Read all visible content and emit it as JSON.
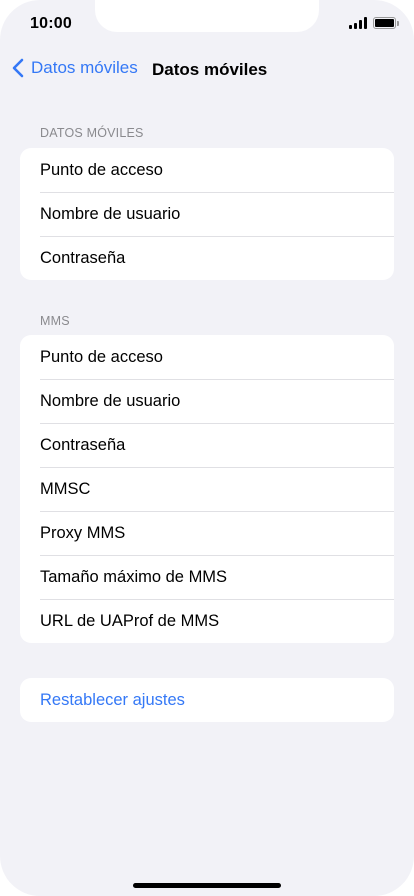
{
  "status_bar": {
    "time": "10:00"
  },
  "nav": {
    "back_label": "Datos móviles",
    "title": "Datos móviles"
  },
  "sections": {
    "datos": {
      "header": "DATOS MÓVILES",
      "items": [
        "Punto de acceso",
        "Nombre de usuario",
        "Contraseña"
      ]
    },
    "mms": {
      "header": "MMS",
      "items": [
        "Punto de acceso",
        "Nombre de usuario",
        "Contraseña",
        "MMSC",
        "Proxy MMS",
        "Tamaño máximo de MMS",
        "URL de UAProf de MMS"
      ]
    },
    "reset": {
      "label": "Restablecer ajustes"
    }
  },
  "colors": {
    "accent": "#3478f6",
    "background": "#f2f2f7",
    "header_text": "#8a8a8e"
  }
}
